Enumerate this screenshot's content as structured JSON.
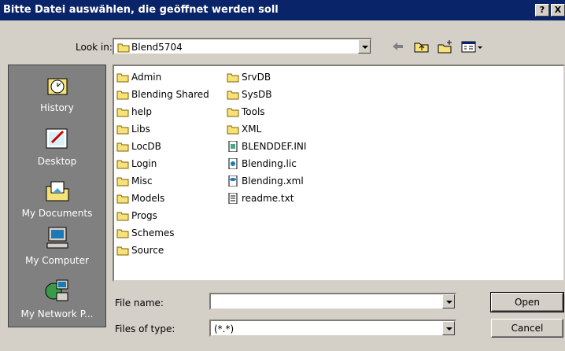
{
  "window": {
    "title": "Bitte Datei auswählen, die geöffnet werden soll",
    "help_label": "?",
    "close_label": "X"
  },
  "lookin": {
    "label": "Look in:",
    "value": "Blend5704"
  },
  "places": [
    {
      "label": "History",
      "icon": "history-icon"
    },
    {
      "label": "Desktop",
      "icon": "desktop-icon"
    },
    {
      "label": "My Documents",
      "icon": "my-documents-icon"
    },
    {
      "label": "My Computer",
      "icon": "my-computer-icon"
    },
    {
      "label": "My Network P...",
      "icon": "network-places-icon"
    }
  ],
  "files": {
    "col1": [
      "Admin",
      "Blending Shared",
      "help",
      "Libs",
      "LocDB",
      "Login",
      "Misc",
      "Models",
      "Progs",
      "Schemes",
      "Source"
    ],
    "col2": [
      {
        "name": "SrvDB",
        "type": "folder"
      },
      {
        "name": "SysDB",
        "type": "folder"
      },
      {
        "name": "Tools",
        "type": "folder"
      },
      {
        "name": "XML",
        "type": "folder"
      },
      {
        "name": "BLENDDEF.INI",
        "type": "ini"
      },
      {
        "name": "Blending.lic",
        "type": "lic"
      },
      {
        "name": "Blending.xml",
        "type": "xml"
      },
      {
        "name": "readme.txt",
        "type": "txt"
      }
    ]
  },
  "filename": {
    "label": "File name:",
    "value": ""
  },
  "filetype": {
    "label": "Files of type:",
    "value": "(*.*)"
  },
  "buttons": {
    "open": "Open",
    "cancel": "Cancel"
  },
  "colors": {
    "titlebar": "#0a246a",
    "face": "#d4d0c8",
    "folder": "#f7e27a"
  }
}
